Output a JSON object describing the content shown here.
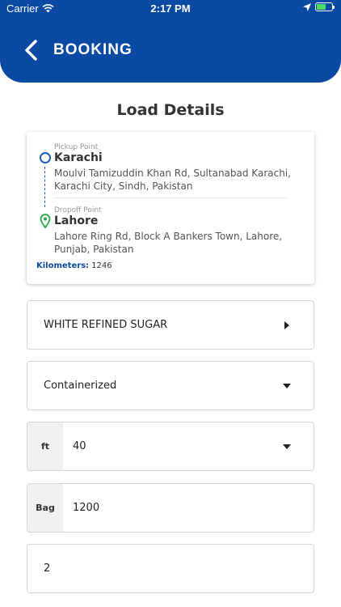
{
  "status_bar": {
    "carrier": "Carrier",
    "time": "2:17 PM"
  },
  "header": {
    "title": "BOOKING"
  },
  "page_title": "Load Details",
  "route": {
    "pickup": {
      "label": "Pickup Point",
      "city": "Karachi",
      "address": "Moulvi Tamizuddin Khan Rd, Sultanabad Karachi, Karachi City, Sindh, Pakistan"
    },
    "dropoff": {
      "label": "Dropoff Point",
      "city": "Lahore",
      "address": "Lahore Ring Rd, Block A Bankers Town, Lahore, Punjab, Pakistan"
    },
    "kilometers_label": "Kilometers:",
    "kilometers_value": "1246"
  },
  "fields": {
    "commodity": {
      "value": "WHITE REFINED SUGAR"
    },
    "load_type": {
      "value": "Containerized"
    },
    "container_size": {
      "prefix": "ft",
      "value": "40"
    },
    "quantity": {
      "prefix": "Bag",
      "value": "1200"
    },
    "count": {
      "value": "2"
    }
  },
  "colors": {
    "primary": "#0a4aa3",
    "pickup_icon": "#1d5fb3",
    "dropoff_icon": "#2aa84a"
  }
}
